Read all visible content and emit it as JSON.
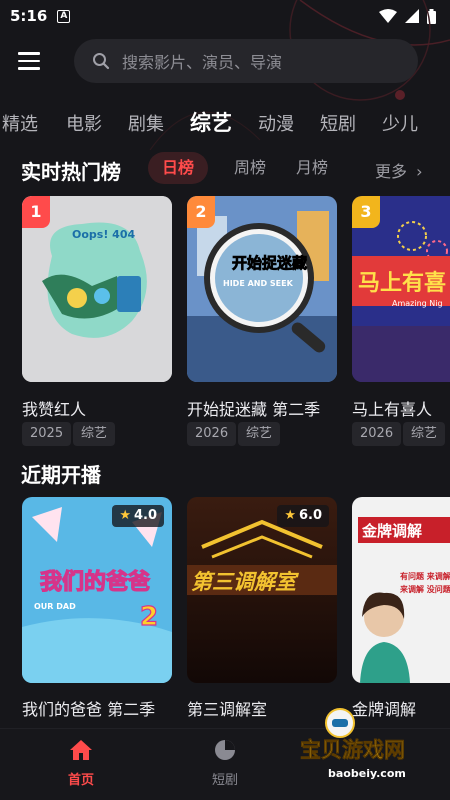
{
  "status_bar": {
    "time": "5:16",
    "notification_badge": "A"
  },
  "search": {
    "placeholder": "搜索影片、演员、导演"
  },
  "category_tabs": [
    "精选",
    "电影",
    "剧集",
    "综艺",
    "动漫",
    "短剧",
    "少儿"
  ],
  "active_category": "综艺",
  "hot_section": {
    "title": "实时热门榜",
    "tabs": [
      "日榜",
      "周榜",
      "月榜"
    ],
    "active_tab": "日榜",
    "more": "更多",
    "items": [
      {
        "rank": "1",
        "title": "我赞红人",
        "year": "2025",
        "genre": "综艺",
        "poster_text": "Oops! 404"
      },
      {
        "rank": "2",
        "title": "开始捉迷藏 第二季",
        "year": "2026",
        "genre": "综艺",
        "poster_text": "开始捉迷藏",
        "poster_sub": "HIDE AND SEEK"
      },
      {
        "rank": "3",
        "title": "马上有喜人",
        "year": "2026",
        "genre": "综艺",
        "poster_text": "马上有喜",
        "poster_sub": "Amazing Nig"
      }
    ]
  },
  "recent_section": {
    "title": "近期开播",
    "items": [
      {
        "title": "我们的爸爸 第二季",
        "rating": "4.0",
        "poster_text": "我们的爸爸",
        "poster_number": "2",
        "poster_sub": "OUR DAD"
      },
      {
        "title": "第三调解室",
        "rating": "6.0",
        "poster_text": "第三调解室"
      },
      {
        "title": "金牌调解",
        "poster_text": "金牌调解",
        "poster_lines": [
          "有问题 来调解",
          "来调解 没问题"
        ]
      }
    ]
  },
  "bottom_nav": [
    {
      "label": "首页",
      "active": true
    },
    {
      "label": "短剧",
      "active": false
    }
  ],
  "watermark": {
    "title": "宝贝游戏网",
    "url": "baobeiy.com"
  },
  "colors": {
    "accent": "#ff4b4b",
    "background": "#16161a",
    "surface": "#26262b"
  }
}
